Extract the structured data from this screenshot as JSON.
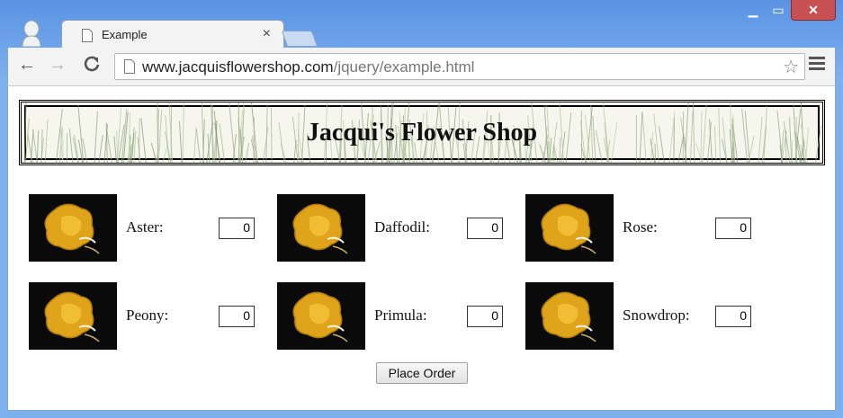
{
  "browser": {
    "tab_title": "Example",
    "tab_close": "×",
    "url_host": "www.jacquisflowershop.com",
    "url_path": "/jquery/example.html",
    "back": "←",
    "forward": "→",
    "reload": "C",
    "star": "☆",
    "minimize": "▁",
    "maximize": "▭",
    "close": "✕",
    "icons": {
      "back": "arrow-left-icon",
      "forward": "arrow-right-icon",
      "reload": "reload-icon",
      "star": "star-icon",
      "menu": "hamburger-icon"
    }
  },
  "page": {
    "heading": "Jacqui's Flower Shop",
    "flowers": [
      {
        "label": "Aster:",
        "qty": "0"
      },
      {
        "label": "Daffodil:",
        "qty": "0"
      },
      {
        "label": "Rose:",
        "qty": "0"
      },
      {
        "label": "Peony:",
        "qty": "0"
      },
      {
        "label": "Primula:",
        "qty": "0"
      },
      {
        "label": "Snowdrop:",
        "qty": "0"
      }
    ],
    "order_button": "Place Order"
  },
  "colors": {
    "frame": "#6fa3e6",
    "close_button": "#c75050",
    "flower_petal": "#e0a41b"
  }
}
